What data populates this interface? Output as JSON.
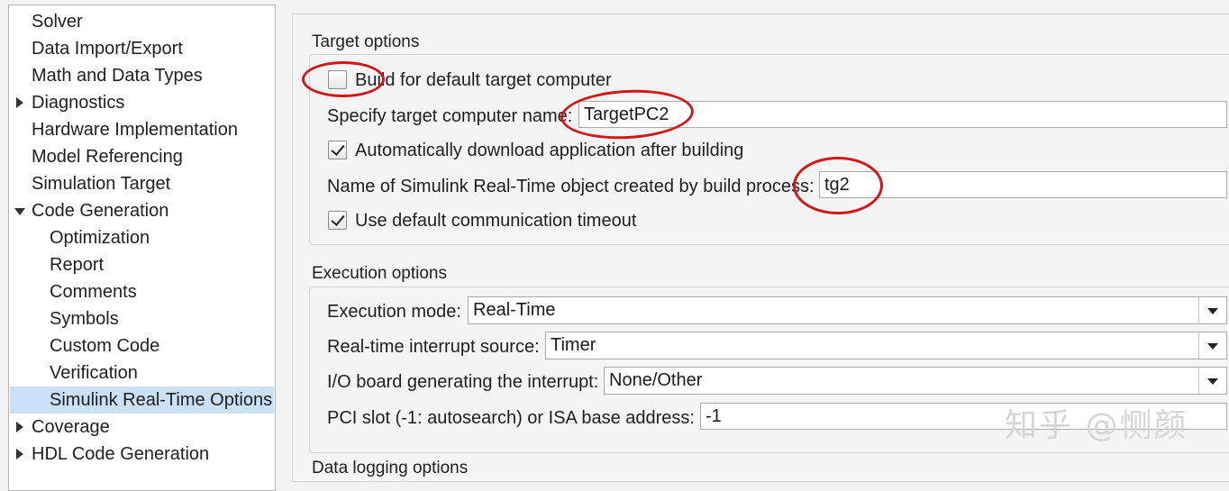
{
  "sidebar": {
    "items": [
      {
        "label": "Solver"
      },
      {
        "label": "Data Import/Export"
      },
      {
        "label": "Math and Data Types"
      },
      {
        "label": "Diagnostics"
      },
      {
        "label": "Hardware Implementation"
      },
      {
        "label": "Model Referencing"
      },
      {
        "label": "Simulation Target"
      },
      {
        "label": "Code Generation"
      },
      {
        "label": "Optimization"
      },
      {
        "label": "Report"
      },
      {
        "label": "Comments"
      },
      {
        "label": "Symbols"
      },
      {
        "label": "Custom Code"
      },
      {
        "label": "Verification"
      },
      {
        "label": "Simulink Real-Time Options"
      },
      {
        "label": "Coverage"
      },
      {
        "label": "HDL Code Generation"
      }
    ]
  },
  "target_options": {
    "title": "Target options",
    "build_default_label": "Build for default target computer",
    "build_default_checked": false,
    "target_name_label": "Specify target computer name:",
    "target_name_value": "TargetPC2",
    "auto_download_label": "Automatically download application after building",
    "auto_download_checked": true,
    "object_name_label": "Name of Simulink Real-Time object created by build process:",
    "object_name_value": "tg2",
    "default_timeout_label": "Use default communication timeout",
    "default_timeout_checked": true
  },
  "execution_options": {
    "title": "Execution options",
    "mode_label": "Execution mode:",
    "mode_value": "Real-Time",
    "interrupt_source_label": "Real-time interrupt source:",
    "interrupt_source_value": "Timer",
    "io_board_label": "I/O board generating the interrupt:",
    "io_board_value": "None/Other",
    "pci_slot_label": "PCI slot (-1: autosearch) or ISA base address:",
    "pci_slot_value": "-1"
  },
  "data_logging_options": {
    "title": "Data logging options"
  },
  "watermark": "知乎 @恻颜",
  "colors": {
    "selection": "#c9e0f7",
    "annotation": "#d01818"
  }
}
